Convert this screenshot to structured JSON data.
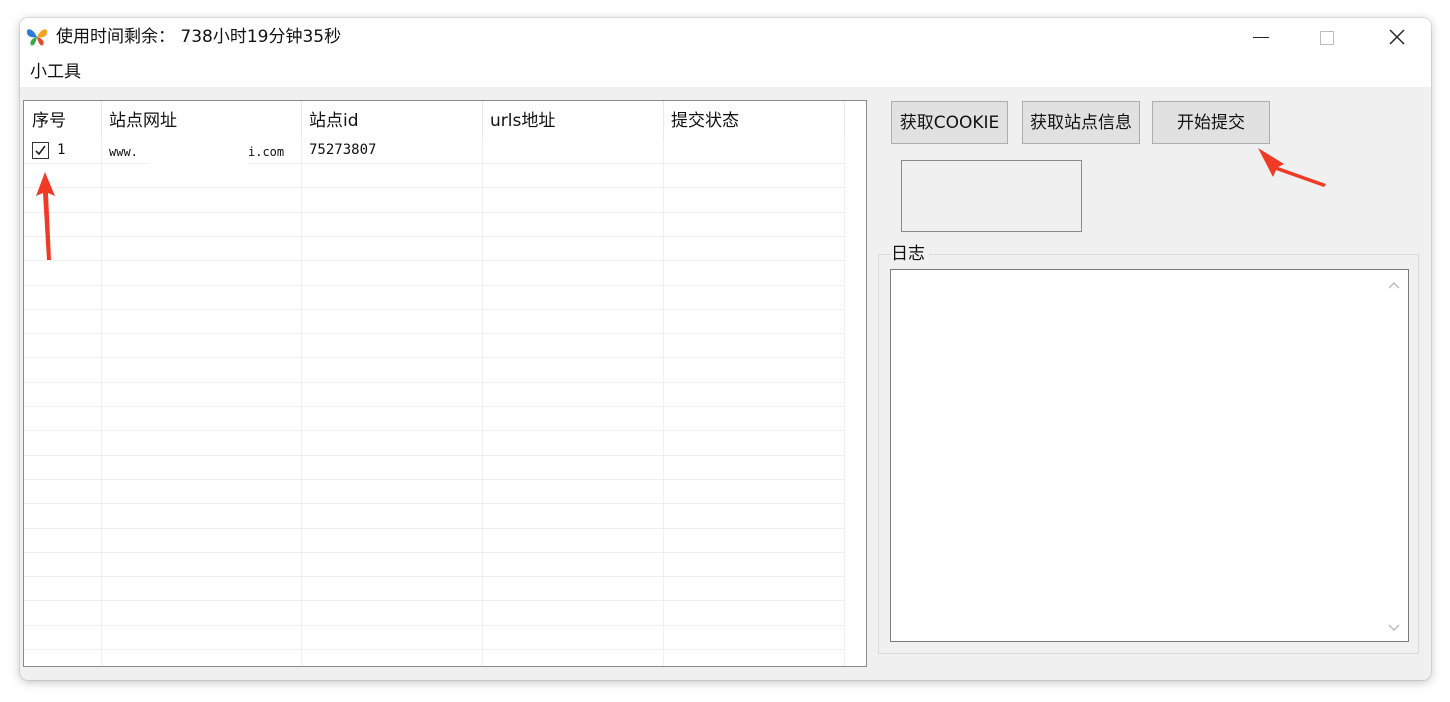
{
  "window": {
    "title": "使用时间剩余： 738小时19分钟35秒",
    "icon": "butterfly-app-icon",
    "controls": [
      "minimize-icon",
      "maximize-icon",
      "close-icon"
    ]
  },
  "menu": {
    "items": [
      "小工具"
    ]
  },
  "table": {
    "columns": [
      "序号",
      "站点网址",
      "站点id",
      "urls地址",
      "提交状态"
    ],
    "rows": [
      {
        "checked": true,
        "index": "1",
        "url_prefix": "www.",
        "url_suffix": "i.com",
        "site_id": "75273807",
        "urls": "",
        "status": ""
      }
    ]
  },
  "buttons": {
    "get_cookie": "获取COOKIE",
    "get_site_info": "获取站点信息",
    "start_submit": "开始提交"
  },
  "log": {
    "label": "日志",
    "content": ""
  },
  "colors": {
    "annotation_arrow": "#f03a25",
    "window_bg": "#f0f0f0",
    "button_bg": "#e1e1e1"
  }
}
